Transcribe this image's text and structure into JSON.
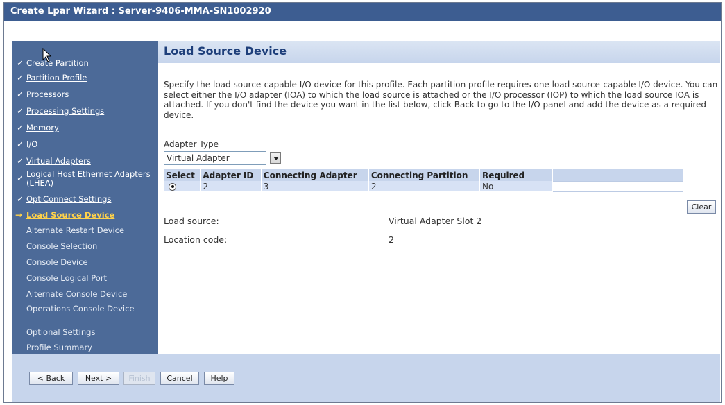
{
  "window": {
    "title": "Create Lpar Wizard : Server-9406-MMA-SN1002920"
  },
  "sidebar": {
    "items": [
      {
        "label": "Create Partition",
        "state": "done"
      },
      {
        "label": "Partition Profile",
        "state": "done"
      },
      {
        "label": "Processors",
        "state": "done"
      },
      {
        "label": "Processing Settings",
        "state": "done"
      },
      {
        "label": "Memory",
        "state": "done"
      },
      {
        "label": "I/O",
        "state": "done"
      },
      {
        "label": "Virtual Adapters",
        "state": "done"
      },
      {
        "label": "Logical Host Ethernet Adapters (LHEA)",
        "state": "done"
      },
      {
        "label": "OptiConnect Settings",
        "state": "done"
      },
      {
        "label": "Load Source Device",
        "state": "current"
      },
      {
        "label": "Alternate Restart Device",
        "state": "todo"
      },
      {
        "label": "Console Selection",
        "state": "todo"
      },
      {
        "label": "Console Device",
        "state": "todo"
      },
      {
        "label": "Console Logical Port",
        "state": "todo"
      },
      {
        "label": "Alternate Console Device",
        "state": "todo"
      },
      {
        "label": "Operations Console Device",
        "state": "todo"
      },
      {
        "label": "Optional Settings",
        "state": "todo"
      },
      {
        "label": "Profile Summary",
        "state": "todo"
      }
    ],
    "check_glyph": "✓",
    "arrow_glyph": "→"
  },
  "main": {
    "title": "Load Source Device",
    "description": "Specify the load source-capable I/O device for this profile. Each partition profile requires one load source-capable I/O device. You can select either the I/O adapter (IOA) to which the load source is attached or the I/O processor (IOP) to which the load source IOA is attached. If you don't find the device you want in the list below, click Back to go to the I/O panel and add the device as a required device.",
    "adapter_type_label": "Adapter Type",
    "adapter_type_value": "Virtual Adapter",
    "table": {
      "headers": [
        "Select",
        "Adapter ID",
        "Connecting Adapter",
        "Connecting Partition",
        "Required"
      ],
      "rows": [
        {
          "selected": true,
          "adapter_id": "2",
          "connecting_adapter": "3",
          "connecting_partition": "2",
          "required": "No"
        }
      ]
    },
    "clear_label": "Clear",
    "load_source_label": "Load source:",
    "load_source_value": "Virtual Adapter Slot 2",
    "location_code_label": "Location code:",
    "location_code_value": "2"
  },
  "footer": {
    "back_label": "< Back",
    "next_label": "Next >",
    "finish_label": "Finish",
    "cancel_label": "Cancel",
    "help_label": "Help"
  },
  "colors": {
    "titlebar": "#3d5d91",
    "sidebar": "#4c6a98",
    "current_step": "#ffd24a",
    "header_band": "#c7d5ec"
  }
}
